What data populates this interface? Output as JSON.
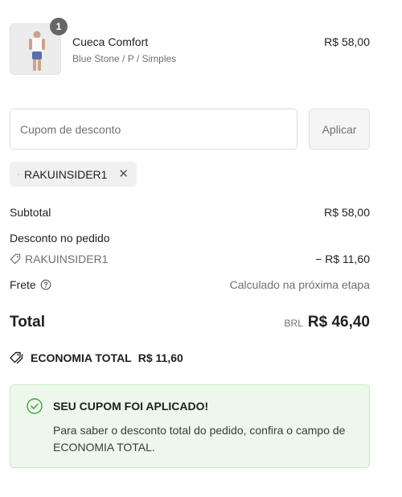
{
  "product": {
    "name": "Cueca Comfort",
    "variant": "Blue Stone / P / Simples",
    "price": "R$ 58,00",
    "quantity": "1"
  },
  "coupon": {
    "placeholder": "Cupom de desconto",
    "apply_label": "Aplicar",
    "applied_code": "RAKUINSIDER1"
  },
  "summary": {
    "subtotal_label": "Subtotal",
    "subtotal_value": "R$ 58,00",
    "discount_label": "Desconto no pedido",
    "discount_code": "RAKUINSIDER1",
    "discount_value": "− R$ 11,60",
    "shipping_label": "Frete",
    "shipping_value": "Calculado na próxima etapa",
    "total_label": "Total",
    "total_currency": "BRL",
    "total_value": "R$ 46,40",
    "savings_label": "ECONOMIA TOTAL",
    "savings_value": "R$ 11,60"
  },
  "success_banner": {
    "title": "SEU CUPOM FOI APLICADO!",
    "message": "Para saber o desconto total do pedido, confira o campo de ECONOMIA TOTAL."
  },
  "colors": {
    "success_bg": "#ecf9ea",
    "success_border": "#c4e9bf",
    "success_icon": "#4a9a4a"
  }
}
